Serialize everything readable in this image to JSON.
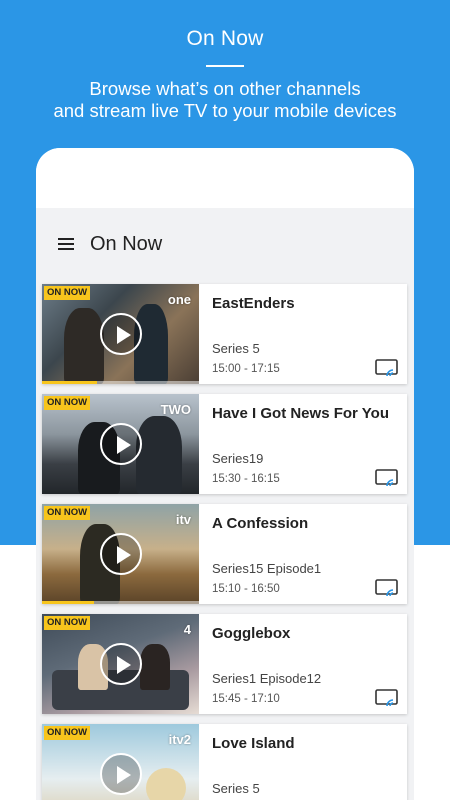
{
  "promo": {
    "title": "On Now",
    "subtitle_line1": "Browse what’s on other channels",
    "subtitle_line2": "and stream live TV to your mobile devices"
  },
  "app": {
    "title": "On Now",
    "badge_label": "ON NOW",
    "accent_color": "#2b96e6",
    "badge_color": "#f7c51c"
  },
  "programmes": [
    {
      "channel": "one",
      "title": "EastEnders",
      "series": "Series 5",
      "time": "15:00  -  17:15",
      "progress": 0.35
    },
    {
      "channel": "TWO",
      "title": "Have I Got News For You",
      "series": "Series19",
      "time": "15:30  -  16:15",
      "progress": 0.0
    },
    {
      "channel": "itv",
      "title": "A Confession",
      "series": "Series15 Episode1",
      "time": "15:10  -  16:50",
      "progress": 0.33
    },
    {
      "channel": "4",
      "title": "Gogglebox",
      "series": "Series1 Episode12",
      "time": "15:45  -  17:10",
      "progress": 0.0
    },
    {
      "channel": "itv2",
      "title": "Love Island",
      "series": "Series 5",
      "time": "",
      "progress": 0.0
    }
  ]
}
